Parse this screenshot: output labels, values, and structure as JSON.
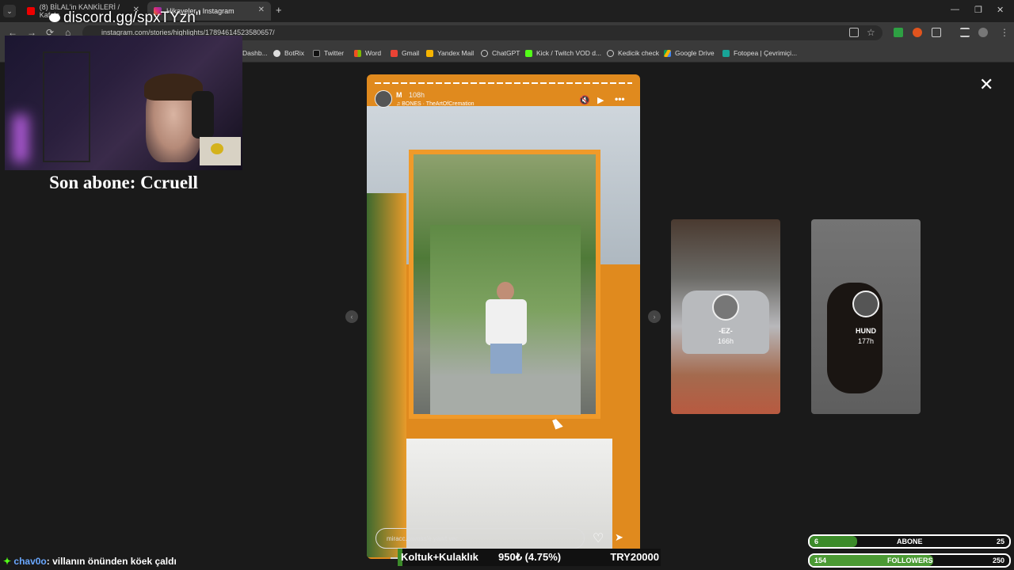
{
  "tabs": [
    {
      "title": "(8) BİLAL'in KANKİLERİ / Kafala"
    },
    {
      "title": "Hikayeler • Instagram"
    }
  ],
  "url": "instagram.com/stories/highlights/17894614523580657/",
  "bookmarks": [
    "Dashb...",
    "BotRix",
    "Twitter",
    "Word",
    "Gmail",
    "Yandex Mail",
    "ChatGPT",
    "Kick / Twitch VOD d...",
    "Kedicik check",
    "Google Drive",
    "Fotopea | Çevrimiçi..."
  ],
  "overlay": {
    "discord": "discord.gg/spxTYzn\"",
    "son_abone": "Son abone: Ccruell"
  },
  "story": {
    "user": "M",
    "age": "108h",
    "music": "BONES · TheArtOfCremation",
    "reply_placeholder": "miracc.cavuss'e yanıt ver..."
  },
  "side_stories": [
    {
      "name": "-EZ-",
      "age": "166h"
    },
    {
      "name": "HUND",
      "age": "177h"
    }
  ],
  "bars": {
    "abone": {
      "left": "6",
      "label": "ABONE",
      "right": "25",
      "progress": 0.24
    },
    "followers": {
      "left": "154",
      "label": "FOLLOWERS",
      "right": "250",
      "progress": 0.62
    }
  },
  "chat": {
    "user": "chav0o",
    "message": ": villanın önünden köek çaldı"
  },
  "goal": {
    "name": "Koltuk+Kulaklık",
    "value": "950₺ (4.75%)",
    "target": "TRY20000"
  },
  "colors": {
    "story_orange": "#e08a1e",
    "bar_green": "#3c8b2a"
  }
}
